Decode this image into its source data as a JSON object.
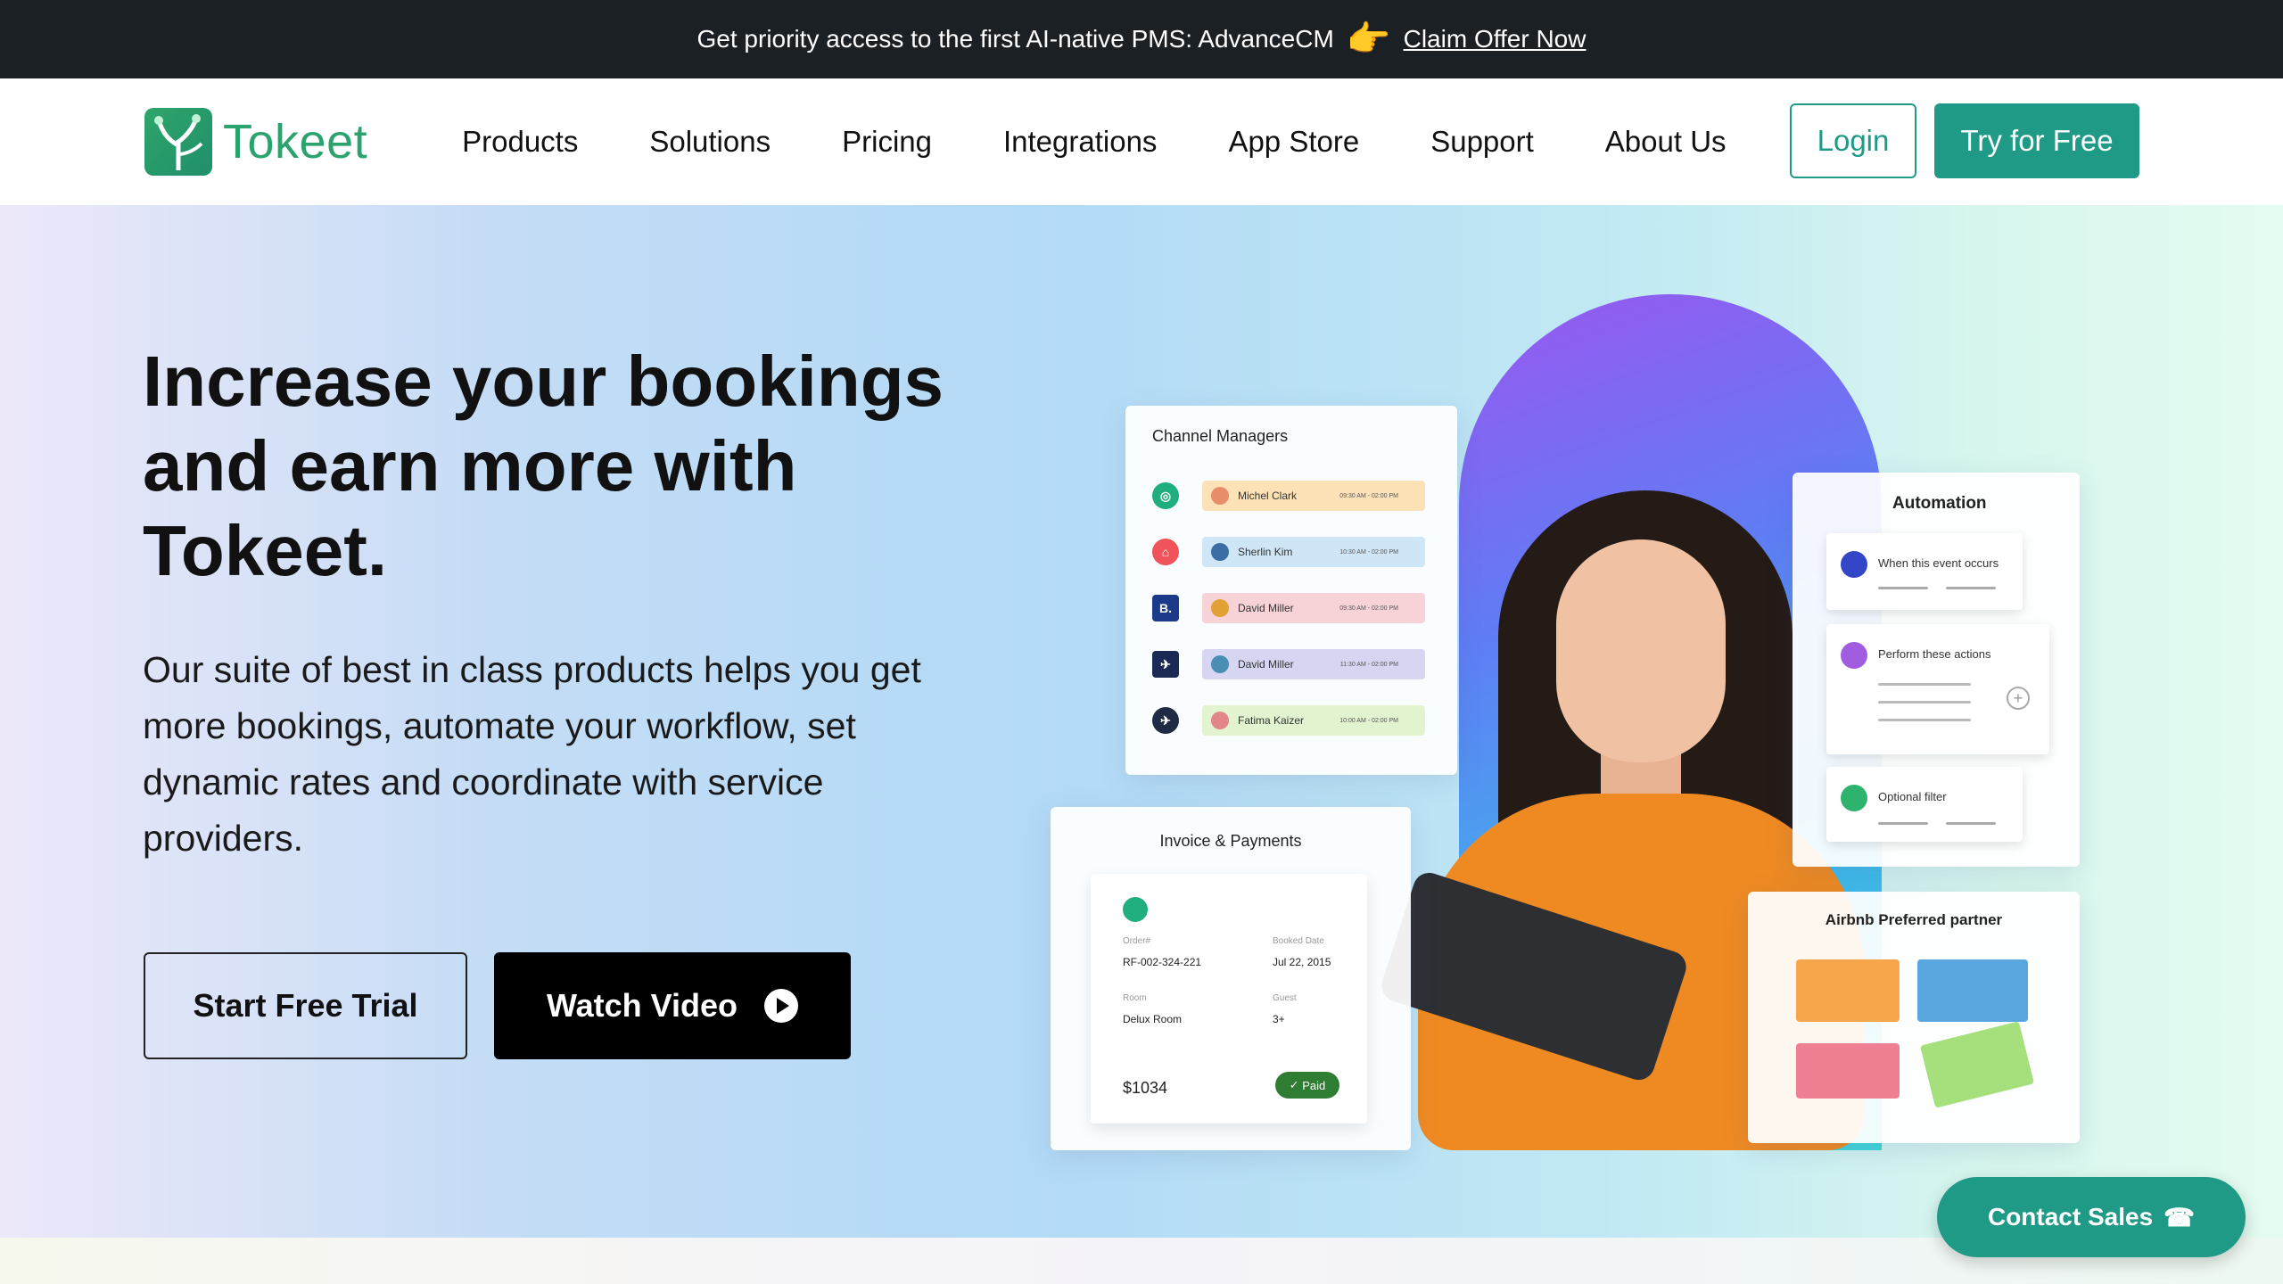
{
  "promo": {
    "text": "Get priority access to the first AI-native PMS: AdvanceCM",
    "icon": "pointing-hand-emoji",
    "link": "Claim Offer Now"
  },
  "header": {
    "logo_text": "Tokeet",
    "nav": [
      "Products",
      "Solutions",
      "Pricing",
      "Integrations",
      "App Store",
      "Support",
      "About Us"
    ],
    "login": "Login",
    "try_free": "Try for Free"
  },
  "hero": {
    "title_lines": [
      "Increase your bookings",
      "and earn more with",
      "Tokeet."
    ],
    "subtitle": "Our suite of best in class products helps you get more bookings, automate your workflow, set dynamic rates and coordinate with service providers.",
    "cta_trial": "Start Free Trial",
    "cta_video": "Watch Video"
  },
  "illustration": {
    "channel_managers": {
      "title": "Channel Managers",
      "rows": [
        {
          "name": "Michel Clark",
          "time": "09:30 AM - 02:00 PM",
          "badge_color": "#1fae7e",
          "pill_color": "#fde2b8"
        },
        {
          "name": "Sherlin Kim",
          "time": "10:30 AM - 02:00 PM",
          "badge_color": "#f0535a",
          "pill_color": "#cfe6f6"
        },
        {
          "name": "David Miller",
          "time": "09:30 AM - 02:00 PM",
          "badge_color": "#1d3a8a",
          "pill_color": "#f7d3d8"
        },
        {
          "name": "David Miller",
          "time": "11:30 AM - 02:00 PM",
          "badge_color": "#1b2a55",
          "pill_color": "#d6d6f2"
        },
        {
          "name": "Fatima Kaizer",
          "time": "10:00 AM - 02:00 PM",
          "badge_color": "#1f2a44",
          "pill_color": "#e1f3cf"
        }
      ]
    },
    "automation": {
      "title": "Automation",
      "items": [
        "When this event occurs",
        "Perform these actions",
        "Optional filter"
      ]
    },
    "invoice": {
      "title": "Invoice & Payments",
      "order_label": "Order#",
      "order_value": "RF-002-324-221",
      "date_label": "Booked Date",
      "date_value": "Jul 22, 2015",
      "room_label": "Room",
      "room_value": "Delux Room",
      "guest_label": "Guest",
      "guest_value": "3+",
      "total": "$1034",
      "status": "Paid"
    },
    "airbnb": {
      "title": "Airbnb Preferred partner"
    }
  },
  "contact": {
    "label": "Contact Sales",
    "icon": "phone-icon"
  },
  "colors": {
    "accent": "#1f9a86",
    "promo_bg": "#1b2024",
    "logo_green": "#2ca36e"
  }
}
